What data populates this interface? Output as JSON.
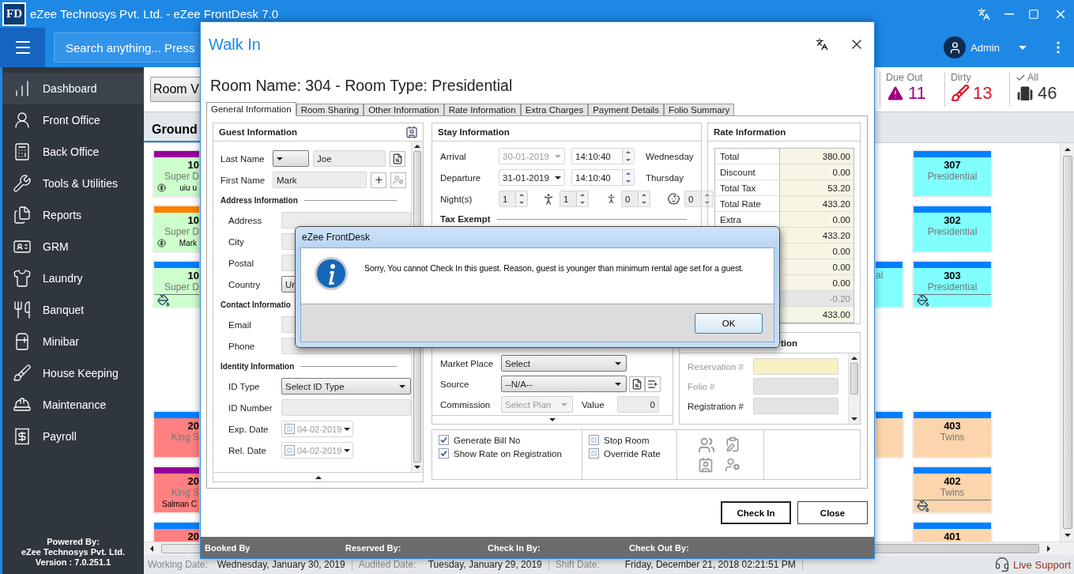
{
  "title_bar": {
    "logo": "FD",
    "title": "eZee Technosys Pvt. Ltd. - eZee FrontDesk 7.0"
  },
  "header": {
    "search": {
      "placeholder": "Search anything... Press"
    },
    "user": "Admin"
  },
  "sidebar": {
    "items": [
      {
        "label": "Dashboard",
        "selected": true
      },
      {
        "label": "Front Office",
        "selected": false
      },
      {
        "label": "Back Office",
        "selected": false
      },
      {
        "label": "Tools & Utilities",
        "selected": false
      },
      {
        "label": "Reports",
        "selected": false
      },
      {
        "label": "GRM",
        "selected": false
      },
      {
        "label": "Laundry",
        "selected": false
      },
      {
        "label": "Banquet",
        "selected": false
      },
      {
        "label": "Minibar",
        "selected": false
      },
      {
        "label": "House Keeping",
        "selected": false
      },
      {
        "label": "Maintenance",
        "selected": false
      },
      {
        "label": "Payroll",
        "selected": false
      }
    ],
    "footer": [
      "Powered By:",
      "eZee Technosys Pvt. Ltd.",
      "Version : 7.0.251.1"
    ]
  },
  "toolbar": {
    "view_button": "Room V",
    "stats": [
      {
        "label": "Due Out",
        "count": "11",
        "color": "#a0007f"
      },
      {
        "label": "Dirty",
        "count": "13",
        "color": "#e0102a"
      },
      {
        "label": "All",
        "count": "46",
        "color": "#333333"
      }
    ]
  },
  "floor_tab": "Ground",
  "room_blocks": [
    {
      "left": [
        {
          "number": "10",
          "type": "Super D",
          "guest": "uiu u",
          "color": "#ccffcc",
          "stripe": {
            "color": "#990099"
          },
          "paid": true,
          "dirty": false
        },
        {
          "number": "10",
          "type": "Super D",
          "guest": "Mark",
          "color": "#ccffcc",
          "stripe": {
            "color": "#ff7f00"
          },
          "paid": true,
          "dirty": false
        },
        {
          "number": "10",
          "type": "Super D",
          "color": "#ccffcc",
          "stripe": {
            "color": "#0080ff"
          },
          "paid": false,
          "dirty": true
        }
      ],
      "middle": [
        {
          "type": "al",
          "color": "#80ffff",
          "stripe": {
            "color": "#0080ff"
          },
          "paid": false,
          "dirty": false
        }
      ],
      "right": [
        {
          "number": "307",
          "type": "Presidential",
          "color": "#80ffff",
          "stripe": {
            "color": "#0080ff"
          },
          "paid": false,
          "dirty": false
        },
        {
          "number": "302",
          "type": "Presidential",
          "color": "#80ffff",
          "stripe": {
            "color": "#0080ff"
          },
          "paid": false,
          "dirty": false
        },
        {
          "number": "303",
          "type": "Presidential",
          "color": "#80ffff",
          "stripe": {
            "color": "#0080ff"
          },
          "paid": false,
          "dirty": true
        }
      ]
    },
    {
      "left": [
        {
          "number": "20",
          "type": "King S",
          "color": "#ff8080",
          "stripe": {
            "color": "#0080ff"
          },
          "paid": false,
          "dirty": false
        },
        {
          "number": "20",
          "type": "King S",
          "guest": "Salman C",
          "color": "#ff8080",
          "stripe": {
            "color": "#990099"
          },
          "paid": false,
          "dirty": false
        },
        {
          "number": "20",
          "color": "#ff8080",
          "stripe": {
            "color": "#0080ff"
          }
        }
      ],
      "middle": [
        {
          "color": "#fdd5ad",
          "stripe": {
            "color": "#0080ff"
          },
          "paid": false,
          "dirty": false
        }
      ],
      "right": [
        {
          "number": "403",
          "type": "Twins",
          "color": "#fdd5ad",
          "stripe": {
            "color": "#0080ff"
          },
          "paid": false,
          "dirty": false
        },
        {
          "number": "402",
          "type": "Twins",
          "color": "#fdd5ad",
          "stripe": {
            "color": "#0080ff"
          },
          "paid": false,
          "dirty": true
        },
        {
          "number": "401",
          "color": "#fdd5ad",
          "stripe": {
            "color": "#0080ff"
          }
        }
      ]
    }
  ],
  "status_bar": {
    "items": [
      {
        "label": "Working Date:",
        "value": "Wednesday, January 30, 2019"
      },
      {
        "label": "Audited Date:",
        "value": "Tuesday, January 29, 2019"
      },
      {
        "label": "Shift Date:",
        "value": "Friday, December 21, 2018 02:21:51 PM"
      }
    ],
    "live_support": "Live Support"
  },
  "walk_in": {
    "title": "Walk In",
    "heading": "Room Name: 304 - Room Type: Presidential",
    "tabs": [
      {
        "label": "General Information",
        "selected": true
      },
      {
        "label": "Room Sharing",
        "selected": false
      },
      {
        "label": "Other Information",
        "selected": false
      },
      {
        "label": "Rate Information",
        "selected": false
      },
      {
        "label": "Extra Charges",
        "selected": false
      },
      {
        "label": "Payment Details",
        "selected": false
      },
      {
        "label": "Folio Summary",
        "selected": false
      }
    ],
    "guest": {
      "title": "Guest Information",
      "last_name": {
        "label": "Last Name",
        "value": "Joe"
      },
      "first_name": {
        "label": "First Name",
        "value": "Mark"
      },
      "sections": [
        {
          "title": "Address Information",
          "fields": [
            {
              "label": "Address",
              "kind": "text"
            },
            {
              "label": "City",
              "kind": "text"
            },
            {
              "label": "Postal",
              "kind": "text"
            },
            {
              "label": "Country",
              "kind": "select",
              "value": "Un"
            }
          ]
        },
        {
          "title": "Contact Informatio",
          "fields": [
            {
              "label": "Email",
              "kind": "text"
            },
            {
              "label": "Phone",
              "kind": "text"
            }
          ]
        },
        {
          "title": "Identity Information",
          "fields": [
            {
              "label": "ID Type",
              "kind": "select",
              "value": "Select ID Type"
            },
            {
              "label": "ID Number",
              "kind": "text"
            },
            {
              "label": "Exp. Date",
              "kind": "date",
              "value": "04-02-2019",
              "checked": false
            },
            {
              "label": "Rel. Date",
              "kind": "date",
              "value": "04-02-2019",
              "checked": false
            }
          ]
        }
      ]
    },
    "stay": {
      "title": "Stay Information",
      "rows": [
        {
          "label": "Arrival",
          "date": "30-01-2019",
          "disabled": true,
          "time": "14:10:40",
          "day": "Wednesday"
        },
        {
          "label": "Departure",
          "date": "31-01-2019",
          "disabled": false,
          "time": "14:10:40",
          "day": "Thursday"
        }
      ],
      "nights": {
        "label": "Night(s)",
        "value": "1"
      },
      "guests": [
        "1",
        "0",
        "0"
      ],
      "tax_exempt": "Tax Exempt"
    },
    "rate": {
      "title": "Rate Information",
      "rows": [
        {
          "label": "Total",
          "value": "380.00",
          "disabled": false
        },
        {
          "label": "Discount",
          "value": "0.00",
          "disabled": false
        },
        {
          "label": "Total Tax",
          "value": "53.20",
          "disabled": false
        },
        {
          "label": "Total Rate",
          "value": "433.20",
          "disabled": false
        },
        {
          "label": "Extra",
          "value": "0.00",
          "disabled": false
        },
        {
          "value": "433.20",
          "disabled": false
        },
        {
          "value": "0.00",
          "disabled": false
        },
        {
          "value": "0.00",
          "disabled": false
        },
        {
          "value": "0.00",
          "disabled": false
        },
        {
          "value": "-0.20",
          "disabled": true
        },
        {
          "value": "433.00",
          "disabled": false
        }
      ]
    },
    "booking": {
      "market_place": {
        "label": "Market Place",
        "value": "Select"
      },
      "source": {
        "label": "Source",
        "value": "--N/A--"
      },
      "commission": {
        "label": "Commission",
        "value": "Select Plan",
        "disabled": true
      },
      "amount": {
        "label": "Value",
        "value": "0"
      }
    },
    "other": {
      "title": "tion",
      "fields": [
        {
          "label": "Reservation #",
          "disabled": true,
          "highlighted": true
        },
        {
          "label": "Folio #",
          "disabled": true,
          "highlighted": false
        },
        {
          "label": "Registration #",
          "disabled": false,
          "highlighted": false
        }
      ]
    },
    "options": [
      [
        {
          "label": "Generate Bill No",
          "checked": true
        },
        {
          "label": "Show Rate on Registration",
          "checked": true
        }
      ],
      [
        {
          "label": "Stop Room",
          "checked": false
        },
        {
          "label": "Override Rate",
          "checked": false
        }
      ]
    ],
    "buttons": [
      {
        "label": "Check In",
        "default": true
      },
      {
        "label": "Close",
        "default": false
      }
    ],
    "footer": [
      "Booked By",
      "Reserved By:",
      "Check In By:",
      "Check Out By:"
    ]
  },
  "message_box": {
    "title": "eZee FrontDesk",
    "message": "Sorry, You cannot Check In this guest. Reason, guest is younger than minimum rental age set for a guest.",
    "button": "OK"
  }
}
